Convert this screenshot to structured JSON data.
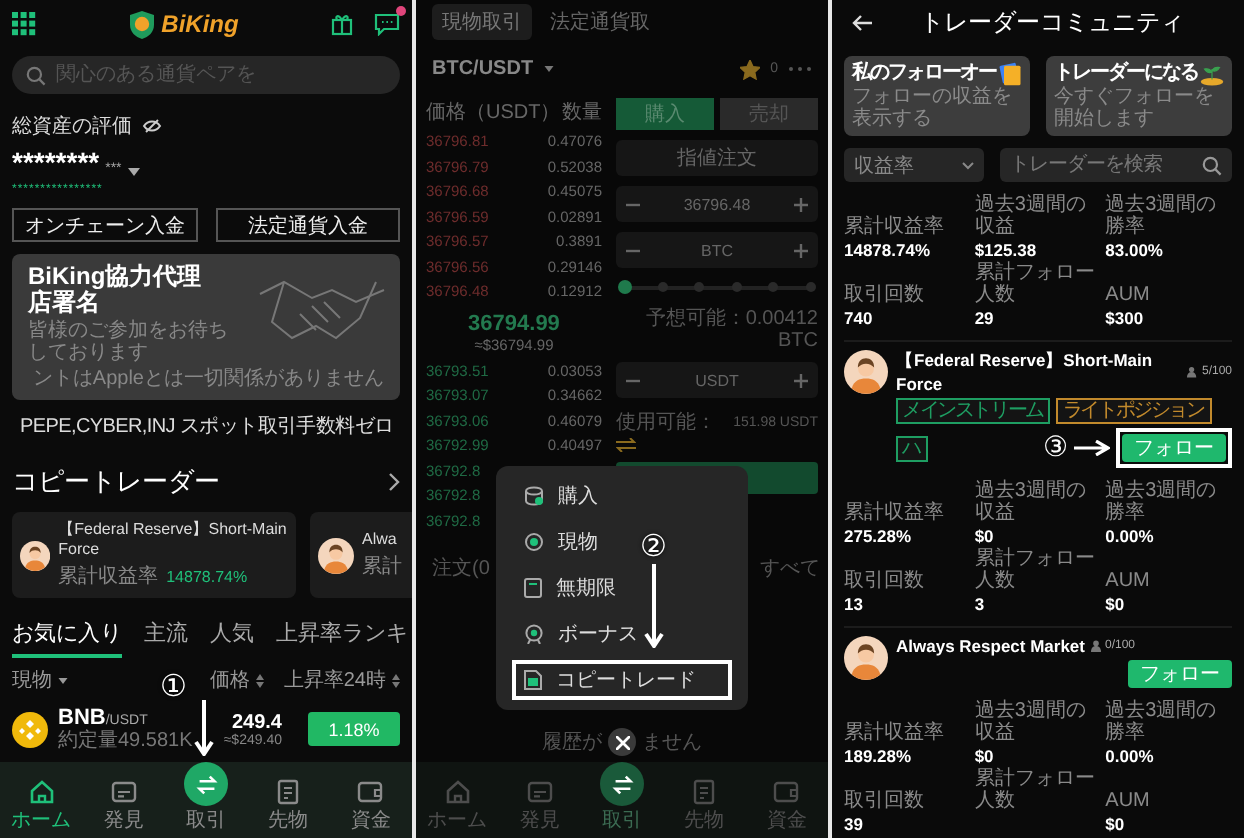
{
  "home_screen": {
    "header": {
      "logo": "BiKing",
      "unread": true
    },
    "search": {
      "placeholder": "関心のある通貨ペアを"
    },
    "assets": {
      "label": "総資産の評価",
      "amount": "********",
      "unit": "***",
      "converted": "****************"
    },
    "deposit_buttons": [
      "オンチェーン入金",
      "法定通貨入金"
    ],
    "banner": {
      "title": "BiKing協力代理店署名",
      "subtitle": "皆様のご参加をお待ちしております",
      "disclaimer": "ントはAppleとは一切関係がありません"
    },
    "announcement": "PEPE,CYBER,INJ スポット取引手数料ゼロ",
    "copy_traders": {
      "title": "コピートレーダー",
      "cards": [
        {
          "name": "【Federal Reserve】Short-Main Force",
          "metric_label": "累計収益率",
          "metric_value": "14878.74%"
        },
        {
          "name": "Alwa",
          "metric_label": "累計"
        }
      ]
    },
    "tabs": [
      {
        "label": "お気に入り",
        "selected": true
      },
      {
        "label": "主流",
        "selected": false
      },
      {
        "label": "人気",
        "selected": false
      },
      {
        "label": "上昇率ランキ",
        "selected": false
      }
    ],
    "list_header": {
      "market": "現物",
      "price": "価格",
      "change": "上昇率24時"
    },
    "rows": [
      {
        "base": "BNB",
        "quote": "/USDT",
        "volume": "約定量49.581K",
        "price": "249.4",
        "fiat": "≈$249.40",
        "change": "1.18%"
      }
    ],
    "nav": [
      {
        "kind": "home",
        "label": "ホーム",
        "selected": true
      },
      {
        "kind": "discover",
        "label": "発見",
        "selected": false
      },
      {
        "kind": "trade",
        "label": "取引",
        "selected": false
      },
      {
        "kind": "futures",
        "label": "先物",
        "selected": false
      },
      {
        "kind": "funds",
        "label": "資金",
        "selected": false
      }
    ],
    "annotation": "①"
  },
  "trade_screen": {
    "top_tabs": [
      {
        "label": "現物取引",
        "selected": true
      },
      {
        "label": "法定通貨取",
        "selected": false
      }
    ],
    "pair": "BTC/USDT",
    "favorite": true,
    "badge": "0",
    "order_book": {
      "price_header": "価格（USDT）",
      "qty_header": "数量",
      "asks": [
        {
          "price": "36796.81",
          "qty": "0.47076"
        },
        {
          "price": "36796.79",
          "qty": "0.52038"
        },
        {
          "price": "36796.68",
          "qty": "0.45075"
        },
        {
          "price": "36796.59",
          "qty": "0.02891"
        },
        {
          "price": "36796.57",
          "qty": "0.3891"
        },
        {
          "price": "36796.56",
          "qty": "0.29146"
        },
        {
          "price": "36796.48",
          "qty": "0.12912"
        }
      ],
      "mid": "36794.99",
      "mid_fiat": "≈$36794.99",
      "bids": [
        {
          "price": "36793.51",
          "qty": "0.03053"
        },
        {
          "price": "36793.07",
          "qty": "0.34662"
        },
        {
          "price": "36793.06",
          "qty": "0.46079"
        },
        {
          "price": "36792.99",
          "qty": "0.40497"
        },
        {
          "price": "36792.8"
        },
        {
          "price": "36792.8"
        },
        {
          "price": "36792.8"
        }
      ]
    },
    "side_tabs": [
      {
        "label": "購入",
        "selected": true
      },
      {
        "label": "売却",
        "selected": false
      }
    ],
    "order_type": "指値注文",
    "price_value": "36796.48",
    "amount_unit": "BTC",
    "slider": {
      "level": 0
    },
    "estimate": "予想可能：0.00412 BTC",
    "total_unit": "USDT",
    "available_label": "使用可能：",
    "available_value": "151.98 USDT",
    "orders_title": "注文(0",
    "orders_all": "すべて",
    "empty_before": "履歴が",
    "empty_after": "ません",
    "nav": [
      {
        "kind": "home",
        "label": "ホーム",
        "selected": false
      },
      {
        "kind": "discover",
        "label": "発見",
        "selected": false
      },
      {
        "kind": "trade",
        "label": "取引",
        "selected": true
      },
      {
        "kind": "futures",
        "label": "先物",
        "selected": false
      },
      {
        "kind": "funds",
        "label": "資金",
        "selected": false
      }
    ],
    "menu": [
      {
        "kind": "buy",
        "label": "購入",
        "highlighted": false
      },
      {
        "kind": "spot",
        "label": "現物",
        "highlighted": false
      },
      {
        "kind": "perpetual",
        "label": "無期限",
        "highlighted": false
      },
      {
        "kind": "bonus",
        "label": "ボーナス",
        "highlighted": false
      },
      {
        "kind": "copy",
        "label": "コピートレード",
        "highlighted": true
      }
    ],
    "annotation": "②"
  },
  "community_screen": {
    "title": "トレーダーコミュニティ",
    "cards": [
      {
        "kind": "folder",
        "title": "私のフォローオー",
        "subtitle": "フォローの収益を表示する"
      },
      {
        "kind": "plant",
        "title": "トレーダーになる",
        "subtitle": "今すぐフォローを開始します"
      }
    ],
    "sort": "収益率",
    "search": {
      "placeholder": "トレーダーを検索"
    },
    "leading_stats": [
      {
        "label": "累計収益率",
        "value": "14878.74%"
      },
      {
        "label": "過去3週間の収益",
        "value": "$125.38"
      },
      {
        "label": "過去3週間の勝率",
        "value": "83.00%"
      },
      {
        "label": "取引回数",
        "value": "740"
      },
      {
        "label": "累計フォロー人数",
        "value": "29"
      },
      {
        "label": "AUM",
        "value": "$300"
      }
    ],
    "traders": [
      {
        "name": "【Federal Reserve】Short-Main Force",
        "capacity": "5/100",
        "follow": "フォロー",
        "highlighted": true,
        "tags": [
          {
            "label": "メインストリーム",
            "color": "#1e9e62"
          },
          {
            "label": "ライトポジション",
            "color": "#c28a2c"
          },
          {
            "label": "ハ",
            "color": "#1e9e62"
          }
        ],
        "stats": [
          {
            "label": "累計収益率",
            "value": "275.28%"
          },
          {
            "label": "過去3週間の収益",
            "value": "$0"
          },
          {
            "label": "過去3週間の勝率",
            "value": "0.00%"
          },
          {
            "label": "取引回数",
            "value": "13"
          },
          {
            "label": "累計フォロー人数",
            "value": "3"
          },
          {
            "label": "AUM",
            "value": "$0"
          }
        ]
      },
      {
        "name": "Always Respect Market",
        "capacity": "0/100",
        "follow": "フォロー",
        "highlighted": false,
        "stats": [
          {
            "label": "累計収益率",
            "value": "189.28%"
          },
          {
            "label": "過去3週間の収益",
            "value": "$0"
          },
          {
            "label": "過去3週間の勝率",
            "value": "0.00%"
          },
          {
            "label": "取引回数",
            "value": "39"
          },
          {
            "label": "累計フォロー人数"
          },
          {
            "label": "AUM",
            "value": "$0"
          }
        ]
      }
    ],
    "annotation": "③"
  }
}
